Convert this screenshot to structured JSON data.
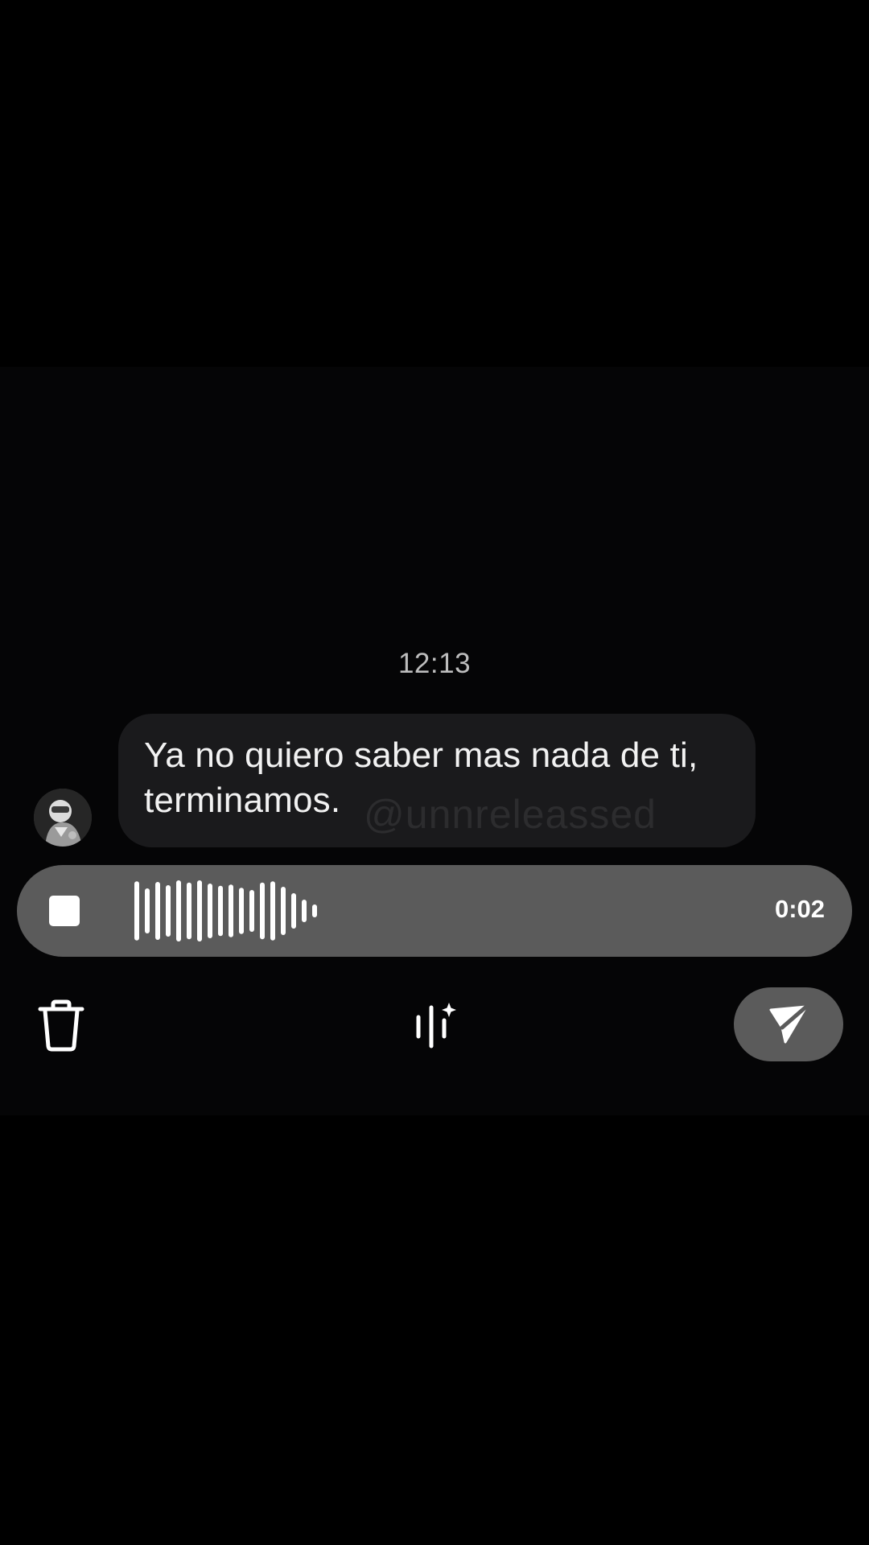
{
  "chat": {
    "timestamp": "12:13",
    "message": {
      "line1": "Ya no quiero saber mas nada de ti,",
      "line2": "terminamos."
    },
    "watermark": "@unnreleassed"
  },
  "recorder": {
    "duration": "0:02",
    "waveform_levels": [
      0.92,
      0.7,
      0.9,
      0.8,
      0.95,
      0.88,
      0.95,
      0.85,
      0.78,
      0.82,
      0.72,
      0.65,
      0.88,
      0.92,
      0.75,
      0.55,
      0.35,
      0.2
    ]
  },
  "actions": {
    "delete_icon": "trash-icon",
    "effects_icon": "audio-effects-icon",
    "send_icon": "send-icon"
  },
  "colors": {
    "background": "#000000",
    "bubble": "#1a1a1c",
    "recorder": "#5b5b5b",
    "text": "#f2f2f2",
    "timestamp": "#bdbdbd"
  }
}
